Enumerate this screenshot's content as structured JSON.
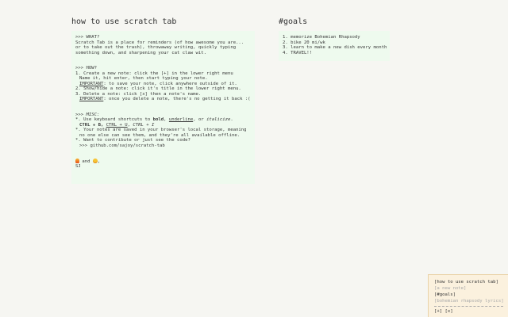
{
  "notes": [
    {
      "title": "how to use scratch tab",
      "lines": {
        "what_h": ">>> WHAT?",
        "what_1": "Scratch Tab is a place for reminders (of how awesome you are...",
        "what_2": "or to take out the trash), throwaway writing, quickly typing",
        "what_3": "something down, and sharpening your cat claw wit.",
        "how_h": ">>> HOW?",
        "how_1": "1. Create a new note: click the [+] in the lower right menu",
        "how_2": "Name it, hit enter, then start typing your note.",
        "how_3a": "IMPORTANT",
        "how_3b": ": to save your note, click anywhere outside of it.",
        "how_4": "2. Show/hide a note: click it's title in the lower right menu.",
        "how_5": "3. Delete a note: click [x] then a note's name.",
        "how_6a": "IMPORTANT",
        "how_6b": ": once you delete a note, there's no getting it back :(",
        "misc_h": ">>> MISC:",
        "misc_1a": "*. Use keyboard shortcuts to ",
        "misc_1b": "bold",
        "misc_1c": ", ",
        "misc_1d": "underline",
        "misc_1e": ", or ",
        "misc_1f": "italicize",
        "misc_1g": ".",
        "misc_2a": "CTRL + B, ",
        "misc_2b": "CTRL + U",
        "misc_2c": ", ",
        "misc_2d": "CTRL + I",
        "misc_3": "*. Your notes are saved in your browser's local storage, meaning",
        "misc_4": "no one else can see them, and they're all available offline.",
        "misc_5": "*. Want to contribute or just see the code?",
        "misc_6": ">>> github.com/sajoy/scratch-tab",
        "sig_and": " and ",
        "sig_comma": ",",
        "sig_name": "SJ"
      }
    },
    {
      "title": "#goals",
      "items": [
        "1. memorize Bohemian Rhapsody",
        "2. bike 20 mi/wk",
        "3. learn to make a new dish every month",
        "4. TRAVEL!!"
      ]
    }
  ],
  "menu": {
    "items": [
      {
        "label": "[how to use scratch tab]",
        "visible": true
      },
      {
        "label": "[a new note]",
        "visible": false
      },
      {
        "label": "[#goals]",
        "visible": true
      },
      {
        "label": "[bohemian rhapsody lyrics]",
        "visible": false
      }
    ],
    "add_label": "[+]",
    "delete_label": "[x]"
  },
  "colors": {
    "background": "#f6f6f2",
    "note_bg": "#eefaee",
    "menu_bg": "#fbf1de",
    "hidden_text": "#a9a9a9"
  },
  "icons": [
    "fire-emoji-icon",
    "heart-eyes-emoji-icon"
  ]
}
